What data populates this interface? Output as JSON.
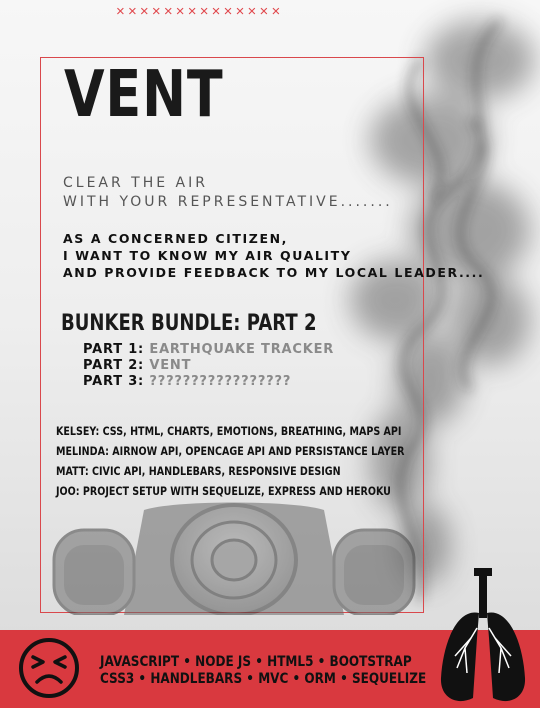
{
  "top_marks": "××××××××××××××",
  "poster": {
    "title": "VENT",
    "tagline_1": "CLEAR THE AIR",
    "tagline_2": "WITH YOUR REPRESENTATIVE.......",
    "intro_1": "AS A CONCERNED CITIZEN,",
    "intro_2": "I WANT TO KNOW MY AIR QUALITY",
    "intro_3": "AND PROVIDE FEEDBACK TO MY LOCAL LEADER....",
    "bundle_title": "BUNKER BUNDLE: PART 2",
    "parts": [
      {
        "label": "PART 1:",
        "value": "EARTHQUAKE TRACKER"
      },
      {
        "label": "PART 2:",
        "value": "VENT"
      },
      {
        "label": "PART 3:",
        "value": "?????????????????"
      }
    ],
    "credits": [
      "KELSEY: CSS, HTML, CHARTS, EMOTIONS, BREATHING, MAPS API",
      "MELINDA: AIRNOW API, OPENCAGE API AND PERSISTANCE LAYER",
      "MATT: CIVIC API, HANDLEBARS, RESPONSIVE DESIGN",
      "JOO: PROJECT SETUP WITH SEQUELIZE, EXPRESS AND HEROKU"
    ],
    "tech_line_1": "JAVASCRIPT • NODE JS • HTML5 • BOOTSTRAP",
    "tech_line_2": "CSS3 • HANDLEBARS • MVC • ORM • SEQUELIZE"
  },
  "icons": {
    "face": "angry-face-icon",
    "lungs": "lungs-icon",
    "mask": "gas-mask-illustration",
    "smoke": "smoke-illustration"
  },
  "colors": {
    "accent": "#d9393f",
    "frame": "#d9484c",
    "text": "#111111",
    "muted": "#8a8a8a"
  }
}
